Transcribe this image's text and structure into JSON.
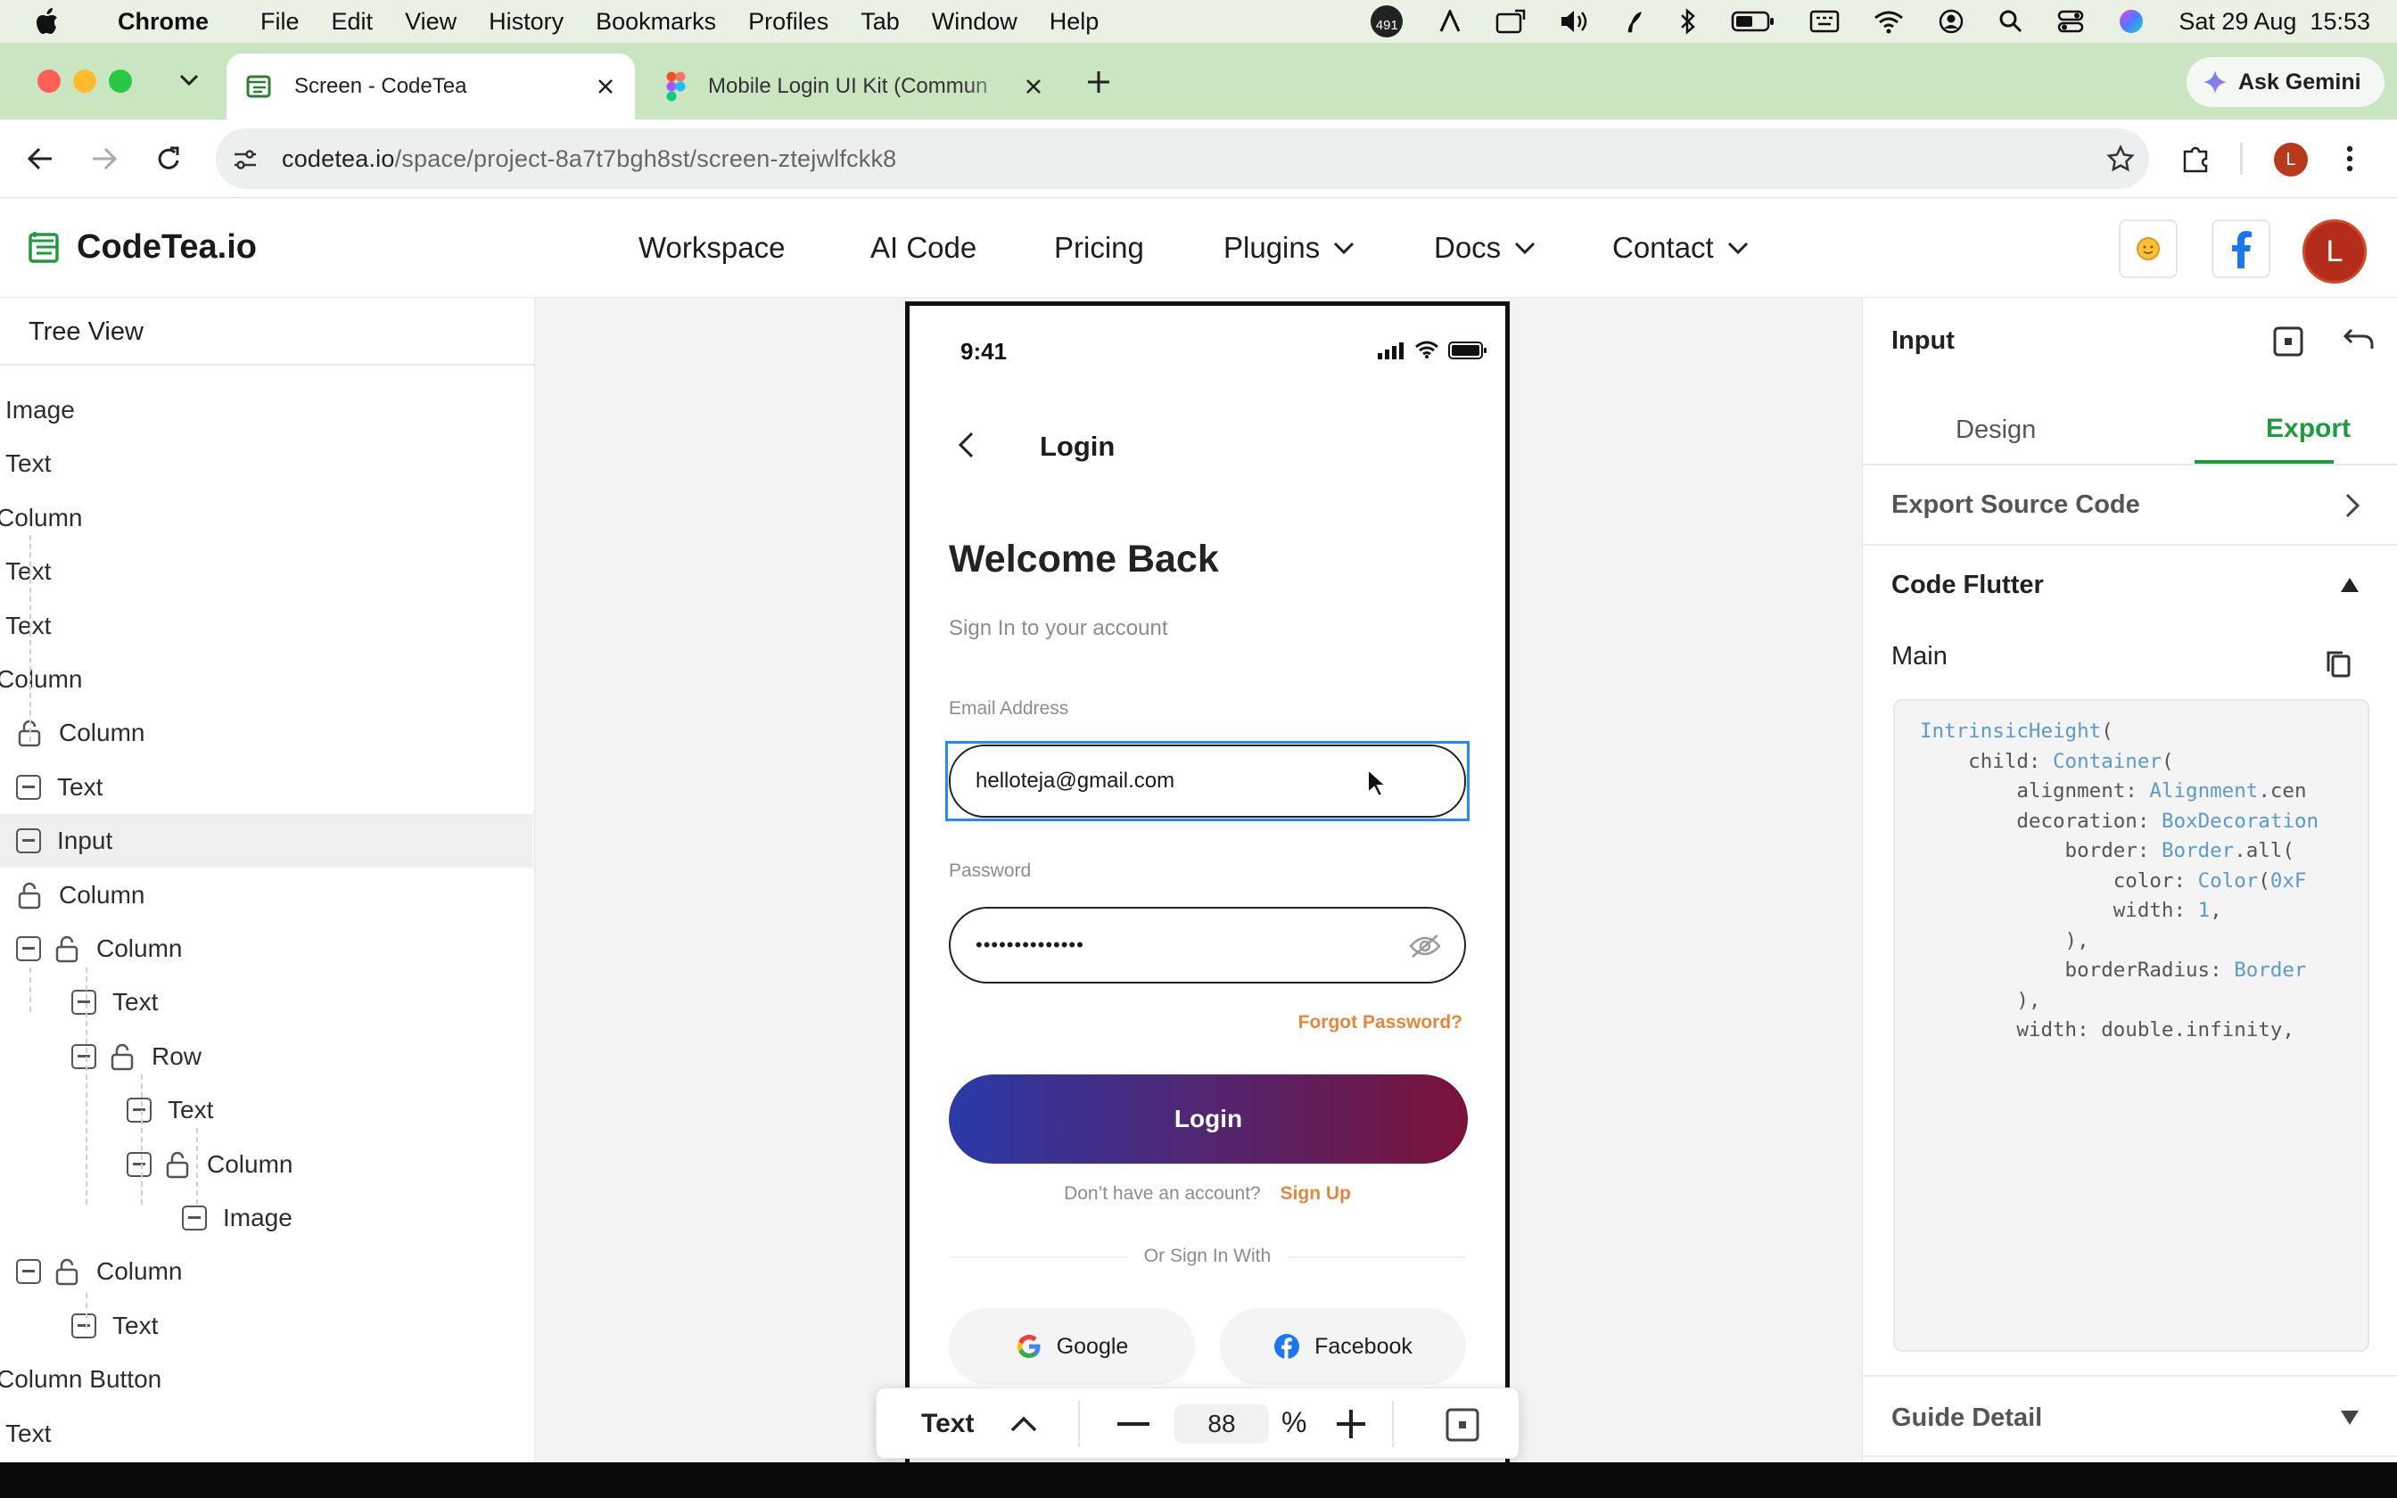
{
  "menubar": {
    "app": "Chrome",
    "items": [
      "File",
      "Edit",
      "View",
      "History",
      "Bookmarks",
      "Profiles",
      "Tab",
      "Window",
      "Help"
    ],
    "badge_count": "491",
    "datetime": "Sat 29 Aug  15:53"
  },
  "browser": {
    "tabs": [
      {
        "title": "Screen - CodeTea",
        "active": true
      },
      {
        "title": "Mobile Login UI Kit (Commun",
        "active": false
      }
    ],
    "ask_gemini": "Ask Gemini",
    "url_host": "codetea.io",
    "url_path": "/space/project-8a7t7bgh8st/screen-ztejwlfckk8",
    "profile_initial": "L"
  },
  "site": {
    "logo": "CodeTea.io",
    "nav": [
      {
        "label": "Workspace",
        "dropdown": false
      },
      {
        "label": "AI Code",
        "dropdown": false
      },
      {
        "label": "Pricing",
        "dropdown": false
      },
      {
        "label": "Plugins",
        "dropdown": true
      },
      {
        "label": "Docs",
        "dropdown": true
      },
      {
        "label": "Contact",
        "dropdown": true
      }
    ],
    "avatar_initial": "L"
  },
  "tree": {
    "title": "Tree View",
    "items": [
      {
        "label": "Image",
        "depth": 0,
        "collapse": false,
        "lock": false
      },
      {
        "label": "Text",
        "depth": 0,
        "collapse": false,
        "lock": false
      },
      {
        "label": "Column",
        "depth": 0,
        "collapse": false,
        "lock": false
      },
      {
        "label": "Text",
        "depth": 0,
        "collapse": false,
        "lock": false
      },
      {
        "label": "Text",
        "depth": 0,
        "collapse": false,
        "lock": false
      },
      {
        "label": "Column",
        "depth": 0,
        "collapse": false,
        "lock": false
      },
      {
        "label": "Column",
        "depth": 1,
        "collapse": false,
        "lock": true
      },
      {
        "label": "Text",
        "depth": 1,
        "collapse": true,
        "lock": false
      },
      {
        "label": "Input",
        "depth": 1,
        "collapse": true,
        "lock": false,
        "selected": true
      },
      {
        "label": "Column",
        "depth": 1,
        "collapse": false,
        "lock": true
      },
      {
        "label": "Column",
        "depth": 1,
        "collapse": true,
        "lock": true
      },
      {
        "label": "Text",
        "depth": 2,
        "collapse": true,
        "lock": false
      },
      {
        "label": "Row",
        "depth": 2,
        "collapse": true,
        "lock": true
      },
      {
        "label": "Text",
        "depth": 3,
        "collapse": true,
        "lock": false
      },
      {
        "label": "Column",
        "depth": 3,
        "collapse": true,
        "lock": true
      },
      {
        "label": "Image",
        "depth": 4,
        "collapse": true,
        "lock": false
      },
      {
        "label": "Column",
        "depth": 1,
        "collapse": true,
        "lock": true
      },
      {
        "label": "Text",
        "depth": 2,
        "collapse": true,
        "lock": false
      },
      {
        "label": "Column Button",
        "depth": 0,
        "collapse": false,
        "lock": false
      },
      {
        "label": "Text",
        "depth": 0,
        "collapse": false,
        "lock": false
      }
    ]
  },
  "phone": {
    "time": "9:41",
    "header_title": "Login",
    "welcome": "Welcome Back",
    "subtitle": "Sign In to your account",
    "email_label": "Email Address",
    "email_value": "helloteja@gmail.com",
    "password_label": "Password",
    "password_value": "••••••••••••••",
    "forgot": "Forgot Password?",
    "login_button": "Login",
    "no_account": "Don’t have an account?",
    "sign_up": "Sign Up",
    "or_sign_in": "Or Sign In With",
    "google": "Google",
    "facebook": "Facebook"
  },
  "zoombar": {
    "element_type": "Text",
    "zoom_value": "88",
    "percent": "%"
  },
  "inspector": {
    "title": "Input",
    "tabs": [
      "Design",
      "Export"
    ],
    "active_tab": "Export",
    "export_source": "Export Source Code",
    "code_flutter": "Code Flutter",
    "main_label": "Main",
    "code_lines": [
      "IntrinsicHeight(",
      "    child: Container(",
      "        alignment: Alignment.cen",
      "        decoration: BoxDecoration",
      "            border: Border.all(",
      "                color: Color(0xF",
      "                width: 1,",
      "            ),",
      "            borderRadius: Border",
      "        ),",
      "        width: double.infinity,"
    ],
    "guide_detail": "Guide Detail"
  },
  "colors": {
    "brand_green": "#2e7d32",
    "accent_green": "#1e9b3c",
    "orange": "#e5873a",
    "login_gradient_start": "#2a3aa8",
    "login_gradient_end": "#7a1238",
    "input_focus_blue": "#1f8bff"
  }
}
